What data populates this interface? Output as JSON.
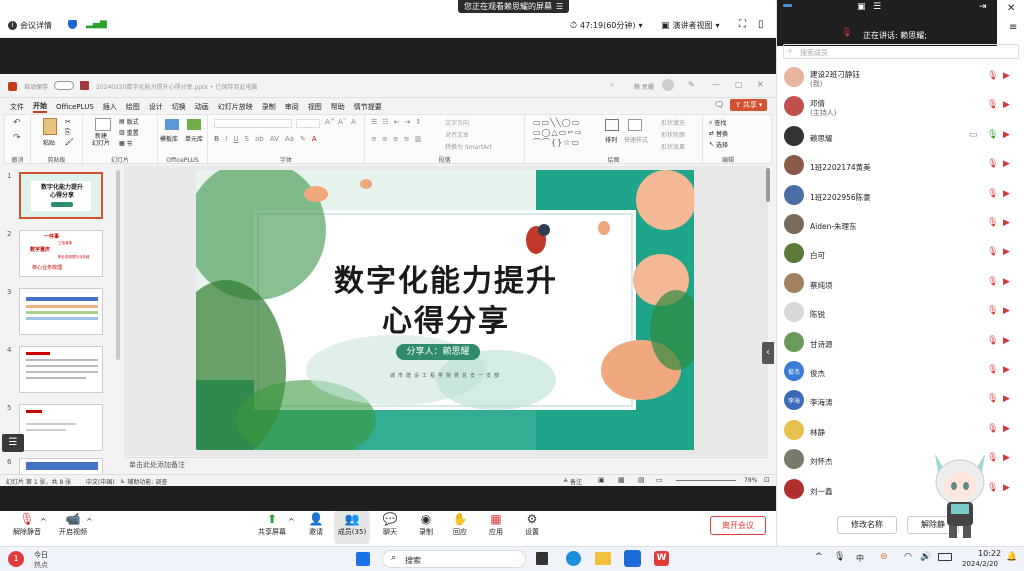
{
  "topbar": {
    "meeting_info": "会议详情",
    "viewing_banner": "您正在观看赖思耀的屏幕",
    "timer": "47:19(60分钟)",
    "view_mode": "演讲者视图",
    "members": "成员(35)"
  },
  "ppt": {
    "autosave": "自动保存",
    "title": "20240220数字化能力提升心得分享.pptx • 已保存到此电脑",
    "user": "赖 思耀",
    "menu": [
      "文件",
      "开始",
      "OfficePLUS",
      "插入",
      "绘图",
      "设计",
      "切换",
      "动画",
      "幻灯片放映",
      "录制",
      "审阅",
      "视图",
      "帮助",
      "情节提要"
    ],
    "share_btn": "共享",
    "groups": [
      "剪贴板",
      "幻灯片",
      "OfficePLUS",
      "字体",
      "段落",
      "绘图",
      "编辑"
    ],
    "ribbon": {
      "paste": "粘贴",
      "new_slide": "新建\n幻灯片",
      "layout": "版式",
      "reset": "重置",
      "section": "节",
      "template": "模板库",
      "unit": "单元库",
      "arrange": "排列",
      "quick_style": "快速样式",
      "find": "查找",
      "replace": "替换",
      "select": "选择",
      "text_dir": "文字方向",
      "align_text": "对齐文本",
      "smartart": "转换为 SmartArt",
      "fill": "形状填充",
      "outline": "形状轮廓",
      "effect": "形状效果"
    },
    "slide_nums": [
      "1",
      "2",
      "3",
      "4",
      "5",
      "6"
    ],
    "thumb1_title": "数字化能力提升\n心得分享",
    "thumb2": {
      "l1": "一件事",
      "l2": "数字重庆",
      "l3": "核心业务梳理",
      "l4": "职业务梳理与业务链",
      "l5": "三张清单"
    },
    "slide": {
      "title_line1": "数字化能力提升",
      "title_line2": "心得分享",
      "presenter": "分享人：赖思耀",
      "org": "城市建设工程学院党总支一支部"
    },
    "notes": "单击此处添加备注",
    "status": {
      "slide_info": "幻灯片 第 1 张，共 8 张",
      "lang": "中文(中国)",
      "accessibility": "辅助功能: 调查",
      "notes_btn": "备注",
      "zoom": "78%"
    }
  },
  "toolbar": {
    "mute": "解除静音",
    "video": "开启视频",
    "share": "共享屏幕",
    "invite": "邀请",
    "members": "成员(35)",
    "chat": "聊天",
    "record": "录制",
    "reaction": "回应",
    "apps": "应用",
    "settings": "设置",
    "leave": "离开会议"
  },
  "panel": {
    "speaking": "正在讲话:  赖思耀;",
    "search_placeholder": "搜索成员",
    "members": [
      {
        "name": "建设2班刁静钰",
        "role": "(我)",
        "color": "#e8b4a0"
      },
      {
        "name": "邓倩",
        "role": "(主持人)",
        "color": "#c0504d"
      },
      {
        "name": "赖思耀",
        "role": "",
        "color": "#333333"
      },
      {
        "name": "1班2202174黄美",
        "role": "",
        "color": "#8a5a4a"
      },
      {
        "name": "1班2202956陈豪",
        "role": "",
        "color": "#4a6fa5"
      },
      {
        "name": "Aiden-朱理东",
        "role": "",
        "color": "#7a6a5a"
      },
      {
        "name": "白可",
        "role": "",
        "color": "#5a7a3a"
      },
      {
        "name": "蔡纯顷",
        "role": "",
        "color": "#a08060"
      },
      {
        "name": "陈锐",
        "role": "",
        "color": "#d8d8d8"
      },
      {
        "name": "甘诗源",
        "role": "",
        "color": "#6a9a5a"
      },
      {
        "name": "俊杰",
        "role": "",
        "color": "#3a7ad8"
      },
      {
        "name": "李海涛",
        "role": "",
        "color": "#3a6ab8"
      },
      {
        "name": "林静",
        "role": "",
        "color": "#e8c050"
      },
      {
        "name": "刘怀杰",
        "role": "",
        "color": "#7a7a6a"
      },
      {
        "name": "刘一鑫",
        "role": "",
        "color": "#b03030"
      }
    ],
    "avatar_text": {
      "junjie": "俊杰",
      "lihaitao": "李海"
    },
    "rename": "修改名称",
    "unmute": "解除静"
  },
  "taskbar": {
    "weather_line1": "今日",
    "weather_line2": "热点",
    "search": "搜索",
    "ime": "中",
    "time": "10:22",
    "date": "2024/2/20"
  }
}
